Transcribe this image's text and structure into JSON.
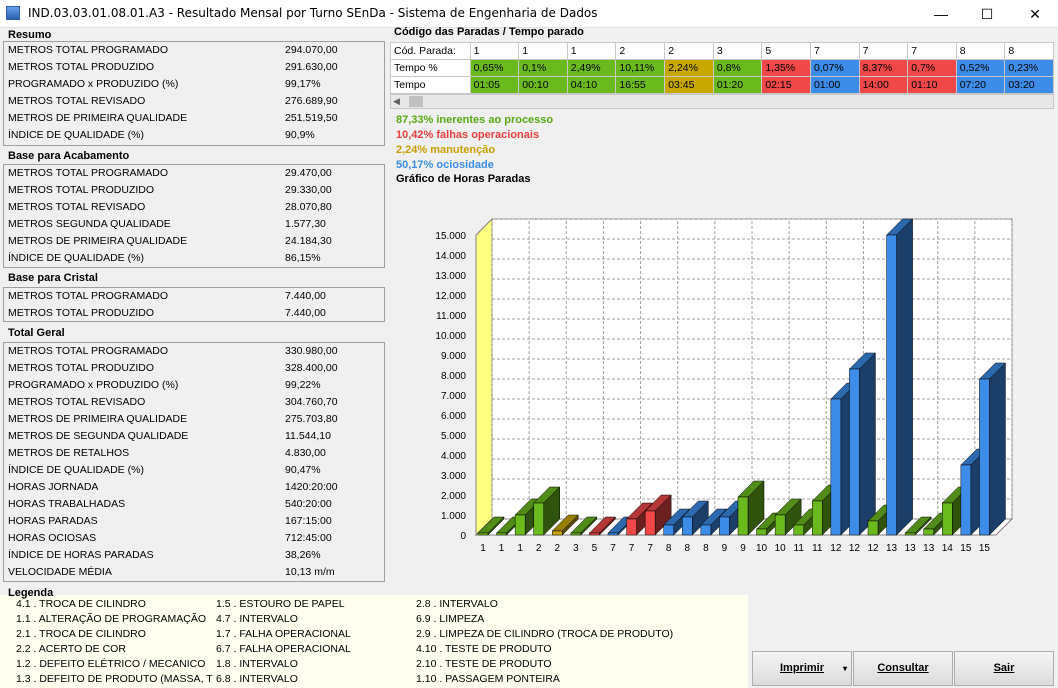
{
  "window": {
    "title": "IND.03.03.01.08.01.A3 - Resultado Mensal por Turno SEnDa - Sistema de Engenharia de Dados",
    "minimize": "—",
    "maximize": "☐",
    "close": "✕"
  },
  "resumo": {
    "title": "Resumo",
    "rows": [
      {
        "label": "METROS TOTAL PROGRAMADO",
        "value": "294.070,00"
      },
      {
        "label": "METROS TOTAL PRODUZIDO",
        "value": "291.630,00"
      },
      {
        "label": "PROGRAMADO x PRODUZIDO (%)",
        "value": "99,17%"
      },
      {
        "label": "METROS TOTAL REVISADO",
        "value": "276.689,90"
      },
      {
        "label": "METROS DE PRIMEIRA QUALIDADE",
        "value": "251.519,50"
      },
      {
        "label": "ÍNDICE DE QUALIDADE (%)",
        "value": "90,9%"
      }
    ]
  },
  "acabamento": {
    "title": "Base para Acabamento",
    "rows": [
      {
        "label": "METROS TOTAL PROGRAMADO",
        "value": "29.470,00"
      },
      {
        "label": "METROS TOTAL PRODUZIDO",
        "value": "29.330,00"
      },
      {
        "label": "METROS TOTAL REVISADO",
        "value": "28.070,80"
      },
      {
        "label": "METROS SEGUNDA QUALIDADE",
        "value": "1.577,30"
      },
      {
        "label": "METROS DE PRIMEIRA QUALIDADE",
        "value": "24.184,30"
      },
      {
        "label": "ÍNDICE DE QUALIDADE (%)",
        "value": "86,15%"
      }
    ]
  },
  "cristal": {
    "title": "Base para Cristal",
    "rows": [
      {
        "label": "METROS TOTAL PROGRAMADO",
        "value": "7.440,00"
      },
      {
        "label": "METROS TOTAL PRODUZIDO",
        "value": "7.440,00"
      }
    ]
  },
  "total": {
    "title": "Total Geral",
    "rows": [
      {
        "label": "METROS TOTAL PROGRAMADO",
        "value": "330.980,00"
      },
      {
        "label": "METROS TOTAL PRODUZIDO",
        "value": "328.400,00"
      },
      {
        "label": "PROGRAMADO x PRODUZIDO (%)",
        "value": "99,22%"
      },
      {
        "label": "METROS TOTAL REVISADO",
        "value": "304.760,70"
      },
      {
        "label": "METROS DE PRIMEIRA QUALIDADE",
        "value": "275.703,80"
      },
      {
        "label": "METROS DE SEGUNDA QUALIDADE",
        "value": "11.544,10"
      },
      {
        "label": "METROS DE RETALHOS",
        "value": "4.830,00"
      },
      {
        "label": "ÍNDICE DE QUALIDADE (%)",
        "value": "90,47%"
      },
      {
        "label": "HORAS JORNADA",
        "value": "1420:20:00"
      },
      {
        "label": "HORAS TRABALHADAS",
        "value": "540:20:00"
      },
      {
        "label": "HORAS PARADAS",
        "value": "167:15:00"
      },
      {
        "label": "HORAS OCIOSAS",
        "value": "712:45:00"
      },
      {
        "label": "ÍNDICE DE HORAS PARADAS",
        "value": "38,26%"
      },
      {
        "label": "VELOCIDADE MÉDIA",
        "value": "10,13 m/m"
      }
    ]
  },
  "paradas": {
    "title": "Código das Paradas / Tempo parado",
    "row_labels": [
      "Cód. Parada:",
      "Tempo %",
      "Tempo"
    ],
    "columns": [
      {
        "code": "1",
        "pct": "0,65%",
        "time": "01:05",
        "color": "#6aba1e"
      },
      {
        "code": "1",
        "pct": "0,1%",
        "time": "00:10",
        "color": "#6aba1e"
      },
      {
        "code": "1",
        "pct": "2,49%",
        "time": "04:10",
        "color": "#6aba1e"
      },
      {
        "code": "2",
        "pct": "10,11%",
        "time": "16:55",
        "color": "#6aba1e"
      },
      {
        "code": "2",
        "pct": "2,24%",
        "time": "03:45",
        "color": "#c8a800"
      },
      {
        "code": "3",
        "pct": "0,8%",
        "time": "01:20",
        "color": "#6aba1e"
      },
      {
        "code": "5",
        "pct": "1,35%",
        "time": "02:15",
        "color": "#f04848"
      },
      {
        "code": "7",
        "pct": "0,07%",
        "time": "01:00",
        "color": "#3c8ce8"
      },
      {
        "code": "7",
        "pct": "8,37%",
        "time": "14:00",
        "color": "#f04848"
      },
      {
        "code": "7",
        "pct": "0,7%",
        "time": "01:10",
        "color": "#f04848"
      },
      {
        "code": "8",
        "pct": "0,52%",
        "time": "07:20",
        "color": "#3c8ce8"
      },
      {
        "code": "8",
        "pct": "0,23%",
        "time": "03:20",
        "color": "#3c8ce8"
      }
    ]
  },
  "stats": [
    {
      "text": "87,33% inerentes ao processo",
      "color": "#5aaa14"
    },
    {
      "text": "10,42% falhas operacionais",
      "color": "#e84040"
    },
    {
      "text": "2,24% manutenção",
      "color": "#c8a000"
    },
    {
      "text": "50,17% ociosidade",
      "color": "#3c8ce8"
    }
  ],
  "chart_data": {
    "type": "bar",
    "title": "Gráfico de Horas Paradas",
    "ylim": [
      0,
      15000
    ],
    "yticks": [
      "0",
      "1.000",
      "2.000",
      "3.000",
      "4.000",
      "5.000",
      "6.000",
      "7.000",
      "8.000",
      "9.000",
      "10.000",
      "11.000",
      "12.000",
      "13.000",
      "14.000",
      "15.000"
    ],
    "grid": true,
    "categories": [
      "1",
      "1",
      "1",
      "2",
      "2",
      "3",
      "5",
      "7",
      "7",
      "7",
      "8",
      "8",
      "8",
      "9",
      "9",
      "10",
      "10",
      "11",
      "11",
      "12",
      "12",
      "12",
      "13",
      "13",
      "13",
      "14",
      "15",
      "15"
    ],
    "values": [
      100,
      100,
      1000,
      1600,
      200,
      100,
      100,
      100,
      800,
      1200,
      500,
      900,
      500,
      900,
      1900,
      300,
      1000,
      500,
      1700,
      6800,
      8300,
      700,
      15000,
      100,
      300,
      1600,
      3500,
      7800
    ],
    "colors": [
      "#6aba1e",
      "#6aba1e",
      "#6aba1e",
      "#6aba1e",
      "#c8a800",
      "#6aba1e",
      "#f04848",
      "#3c8ce8",
      "#f04848",
      "#f04848",
      "#3c8ce8",
      "#3c8ce8",
      "#3c8ce8",
      "#3c8ce8",
      "#6aba1e",
      "#6aba1e",
      "#6aba1e",
      "#6aba1e",
      "#6aba1e",
      "#3c8ce8",
      "#3c8ce8",
      "#6aba1e",
      "#3c8ce8",
      "#6aba1e",
      "#6aba1e",
      "#6aba1e",
      "#3c8ce8",
      "#3c8ce8"
    ]
  },
  "legenda": {
    "title": "Legenda",
    "items": [
      "4.1 . TROCA DE CILINDRO",
      "1.1 . ALTERAÇÃO DE PROGRAMAÇÃO",
      "2.1 . TROCA DE CILINDRO",
      "2.2 . ACERTO DE COR",
      "1.2 . DEFEITO ELÉTRICO / MECANICO",
      "1.3 . DEFEITO DE PRODUTO (MASSA, T",
      "1.5 . ESTOURO DE PAPEL",
      "4.7 . INTERVALO",
      "1.7 . FALHA OPERACIONAL",
      "6.7 . FALHA OPERACIONAL",
      "1.8 . INTERVALO",
      "6.8 . INTERVALO",
      "2.8 . INTERVALO",
      "6.9 . LIMPEZA",
      "2.9 . LIMPEZA DE CILINDRO (TROCA DE PRODUTO)",
      "4.10 . TESTE DE PRODUTO",
      "2.10 . TESTE DE PRODUTO",
      "1.10 . PASSAGEM PONTEIRA"
    ]
  },
  "buttons": {
    "imprimir": "Imprimir",
    "consultar": "Consultar",
    "sair": "Sair"
  }
}
